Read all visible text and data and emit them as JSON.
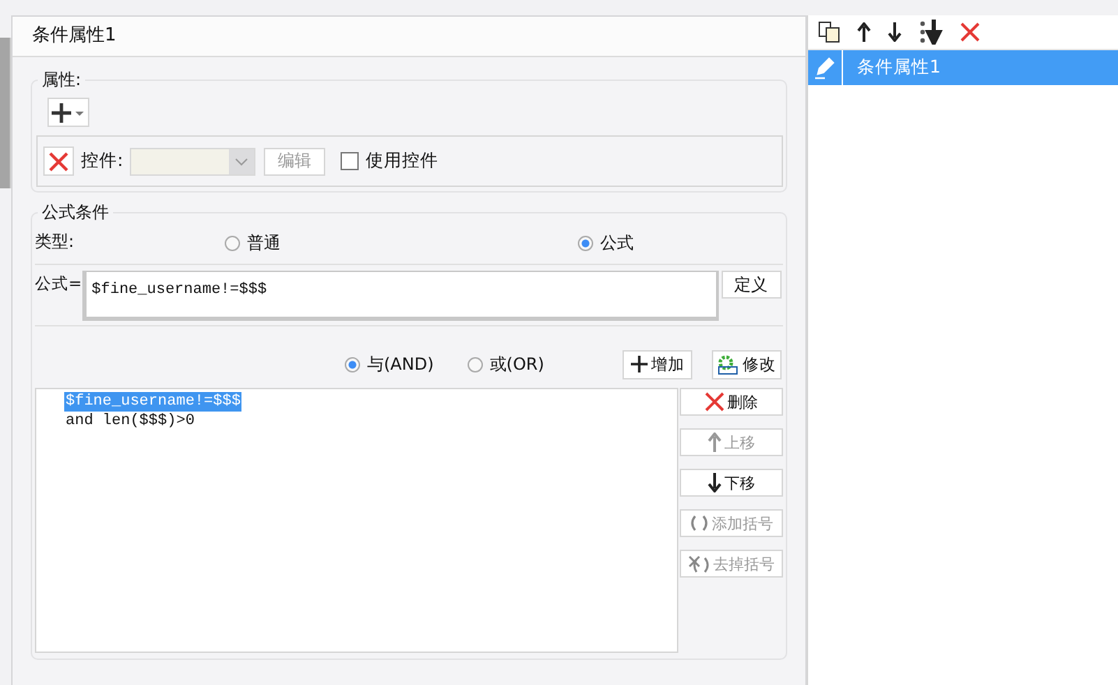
{
  "dialog": {
    "title": "条件属性1"
  },
  "properties_group": {
    "title": "属性:",
    "control_label": "控件:",
    "combo_disabled": true,
    "edit_button": {
      "label": "编辑",
      "disabled": true
    },
    "use_control": {
      "label": "使用控件",
      "checked": false
    }
  },
  "formula_group": {
    "title": "公式条件",
    "type_label": "类型:",
    "type_options": [
      {
        "label": "普通",
        "selected": false
      },
      {
        "label": "公式",
        "selected": true
      }
    ],
    "formula_label": "公式=",
    "formula_value": "$fine_username!=$$$",
    "define_button": "定义",
    "logic_options": [
      {
        "label": "与(AND)",
        "selected": true
      },
      {
        "label": "或(OR)",
        "selected": false
      }
    ],
    "add_button": "增加",
    "modify_button": "修改",
    "condition_lines": [
      {
        "text": "$fine_username!=$$$",
        "selected": true
      },
      {
        "text": "and len($$$)>0",
        "selected": false
      }
    ],
    "side_buttons": [
      {
        "kind": "delete",
        "label": "删除",
        "disabled": false
      },
      {
        "kind": "up",
        "label": "上移",
        "disabled": true
      },
      {
        "kind": "down",
        "label": "下移",
        "disabled": false
      },
      {
        "kind": "add_paren",
        "label": "添加括号",
        "disabled": true
      },
      {
        "kind": "remove_paren",
        "label": "去掉括号",
        "disabled": true
      }
    ]
  },
  "right_panel": {
    "items": [
      {
        "label": "条件属性1",
        "selected": true
      }
    ]
  }
}
